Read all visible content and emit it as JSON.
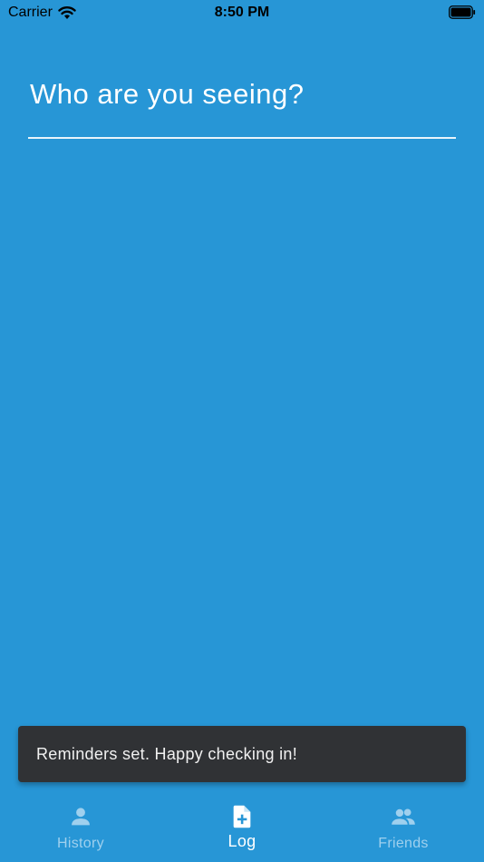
{
  "status_bar": {
    "carrier": "Carrier",
    "time": "8:50 PM",
    "wifi_icon": "wifi-icon",
    "battery_icon": "battery-icon"
  },
  "main": {
    "input_placeholder": "Who are you seeing?"
  },
  "snackbar": {
    "message": "Reminders set. Happy checking in!"
  },
  "bottom_nav": {
    "items": [
      {
        "label": "History",
        "icon": "person-icon",
        "active": false
      },
      {
        "label": "Log",
        "icon": "note-add-icon",
        "active": true
      },
      {
        "label": "Friends",
        "icon": "people-icon",
        "active": false
      }
    ]
  },
  "colors": {
    "background": "#2796d6",
    "snackbar": "#303235",
    "nav_inactive": "#9fd0ee",
    "nav_active": "#ffffff"
  }
}
